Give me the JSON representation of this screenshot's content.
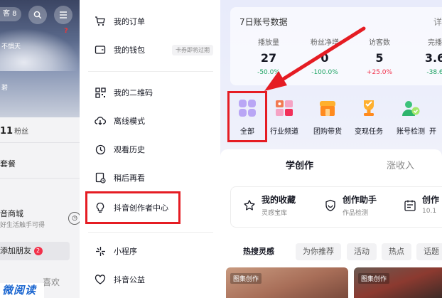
{
  "left_panel": {
    "visitor_label": "客 8",
    "hero_line1": "不惧天",
    "hero_line2": "碧",
    "fans_count": "11",
    "fans_label": "粉丝",
    "package_label": "套餐",
    "shop_title": "音商城",
    "shop_sub": "好生活触手可得",
    "add_friend": "添加朋友",
    "add_friend_badge": "2",
    "like_tab": "喜欢",
    "watermark": "微阅读"
  },
  "menu": {
    "items": [
      {
        "label": "我的订单",
        "icon": "cart-icon"
      },
      {
        "label": "我的钱包",
        "icon": "wallet-icon",
        "tag": "卡券即将过期"
      },
      {
        "label": "我的二维码",
        "icon": "qrcode-icon"
      },
      {
        "label": "离线模式",
        "icon": "cloud-download-icon"
      },
      {
        "label": "观看历史",
        "icon": "clock-icon"
      },
      {
        "label": "稍后再看",
        "icon": "watch-later-icon"
      },
      {
        "label": "抖音创作者中心",
        "icon": "bulb-icon"
      },
      {
        "label": "小程序",
        "icon": "mini-program-icon"
      },
      {
        "label": "抖音公益",
        "icon": "charity-heart-icon"
      }
    ]
  },
  "creator": {
    "stats_title": "7日账号数据",
    "stats_more": "详",
    "stats": [
      {
        "label": "播放量",
        "value": "27",
        "change": "-50.0%",
        "dir": "neg"
      },
      {
        "label": "粉丝净增",
        "value": "0",
        "change": "-100.0%",
        "dir": "neg"
      },
      {
        "label": "访客数",
        "value": "5",
        "change": "+25.0%",
        "dir": "pos"
      },
      {
        "label": "完播",
        "value": "3.6",
        "change": "-38.6",
        "dir": "neg"
      }
    ],
    "tools": [
      {
        "label": "全部",
        "icon": "grid-all-icon"
      },
      {
        "label": "行业频道",
        "icon": "industry-channel-icon"
      },
      {
        "label": "团购带货",
        "icon": "group-buy-icon"
      },
      {
        "label": "变现任务",
        "icon": "trophy-icon"
      },
      {
        "label": "账号检测",
        "icon": "account-check-icon"
      },
      {
        "label": "开",
        "icon": "more-tool-icon"
      }
    ],
    "tabs": {
      "learn": "学创作",
      "grow": "涨收入"
    },
    "shortcuts": [
      {
        "title": "我的收藏",
        "sub": "灵感宝库",
        "icon": "star-icon"
      },
      {
        "title": "创作助手",
        "sub": "作品检测",
        "icon": "shield-smile-icon"
      },
      {
        "title": "创作",
        "sub": "10.1",
        "icon": "calendar-icon"
      }
    ],
    "chips": [
      "热搜灵感",
      "为你推荐",
      "活动",
      "热点",
      "话题"
    ],
    "feed": [
      {
        "label": "图集创作"
      },
      {
        "label": "图集创作"
      }
    ]
  },
  "colors": {
    "highlight_red": "#e51c23",
    "negative_green": "#1aa260",
    "positive_red": "#f2304a"
  }
}
